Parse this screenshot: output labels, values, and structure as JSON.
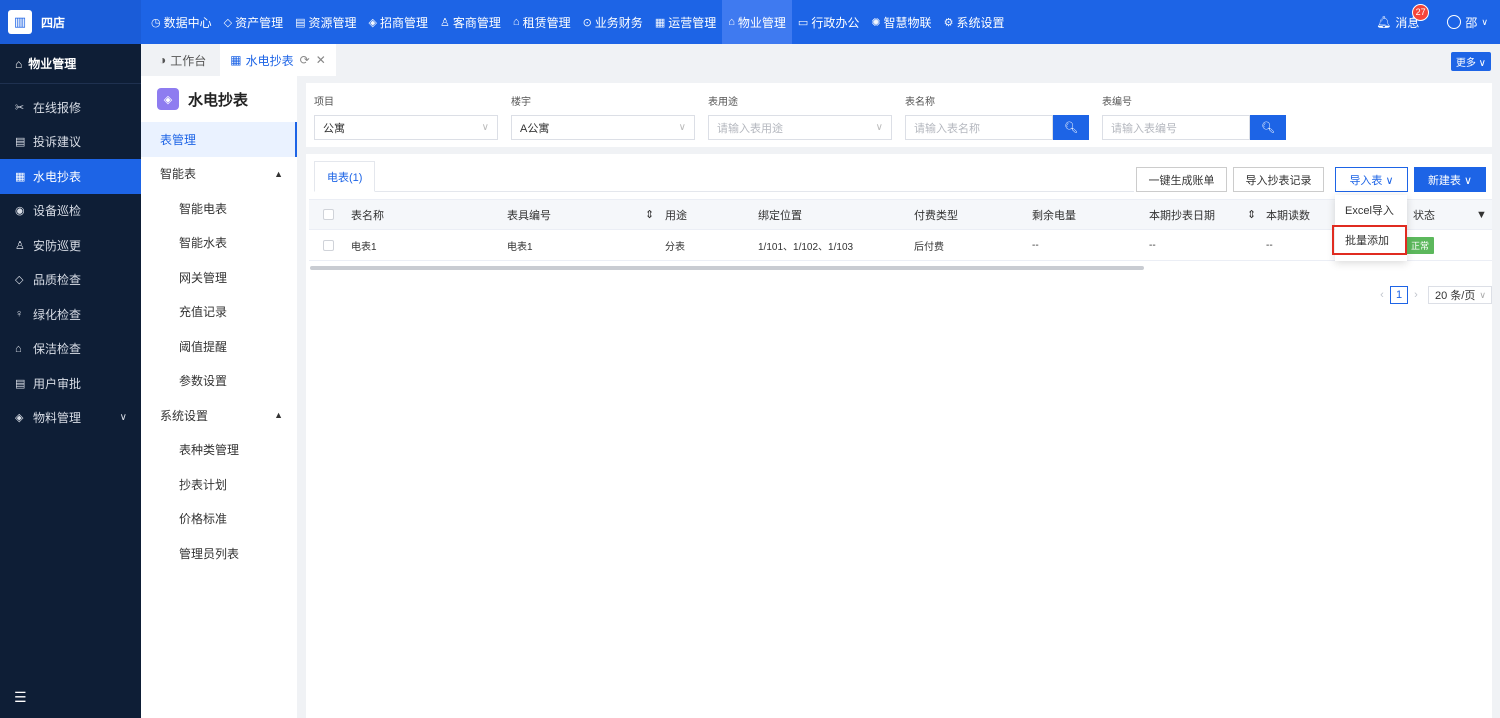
{
  "brand": {
    "name": "四店"
  },
  "nav": [
    {
      "label": "数据中心",
      "icon": "◷"
    },
    {
      "label": "资产管理",
      "icon": "◇"
    },
    {
      "label": "资源管理",
      "icon": "▤"
    },
    {
      "label": "招商管理",
      "icon": "◈"
    },
    {
      "label": "客商管理",
      "icon": "♙"
    },
    {
      "label": "租赁管理",
      "icon": "⌂"
    },
    {
      "label": "业务财务",
      "icon": "⊙"
    },
    {
      "label": "运营管理",
      "icon": "▦"
    },
    {
      "label": "物业管理",
      "icon": "⌂"
    },
    {
      "label": "行政办公",
      "icon": "▭"
    },
    {
      "label": "智慧物联",
      "icon": "✺"
    },
    {
      "label": "系统设置",
      "icon": "⚙"
    }
  ],
  "topright": {
    "messages": "消息",
    "badge": "27",
    "user": "邵"
  },
  "sidebar": {
    "header": "物业管理",
    "items": [
      {
        "label": "在线报修",
        "icon": "✂"
      },
      {
        "label": "投诉建议",
        "icon": "▤"
      },
      {
        "label": "水电抄表",
        "icon": "▦"
      },
      {
        "label": "设备巡检",
        "icon": "◉"
      },
      {
        "label": "安防巡更",
        "icon": "♙"
      },
      {
        "label": "品质检查",
        "icon": "◇"
      },
      {
        "label": "绿化检查",
        "icon": "♀"
      },
      {
        "label": "保洁检查",
        "icon": "⌂"
      },
      {
        "label": "用户审批",
        "icon": "▤"
      },
      {
        "label": "物料管理",
        "icon": "◈"
      }
    ],
    "collapse_icon": "☰"
  },
  "tabs": [
    {
      "label": "工作台",
      "icon": "◑"
    },
    {
      "label": "水电抄表",
      "icon": "▦"
    }
  ],
  "more_label": "更多 ∨",
  "subnav": {
    "title": "水电抄表",
    "items": [
      {
        "label": "表管理"
      },
      {
        "label": "智能表"
      },
      {
        "label": "智能电表"
      },
      {
        "label": "智能水表"
      },
      {
        "label": "网关管理"
      },
      {
        "label": "充值记录"
      },
      {
        "label": "阈值提醒"
      },
      {
        "label": "参数设置"
      },
      {
        "label": "系统设置"
      },
      {
        "label": "表种类管理"
      },
      {
        "label": "抄表计划"
      },
      {
        "label": "价格标准"
      },
      {
        "label": "管理员列表"
      }
    ]
  },
  "filters": {
    "project": {
      "label": "项目",
      "value": "公寓"
    },
    "building": {
      "label": "楼宇",
      "value": "A公寓"
    },
    "usage": {
      "label": "表用途",
      "placeholder": "请输入表用途"
    },
    "meter_name": {
      "label": "表名称",
      "placeholder": "请输入表名称"
    },
    "meter_no": {
      "label": "表编号",
      "placeholder": "请输入表编号"
    }
  },
  "content_tab": "电表(1)",
  "actions": {
    "generate_bill": "一键生成账单",
    "import_records": "导入抄表记录",
    "import_table": "导入表 ∨",
    "new_table": "新建表 ∨"
  },
  "dropdown": {
    "excel_import": "Excel导入",
    "batch_add": "批量添加"
  },
  "table": {
    "headers": [
      "表名称",
      "表具编号",
      "用途",
      "绑定位置",
      "付费类型",
      "剩余电量",
      "本期抄表日期",
      "本期读数",
      "状态"
    ],
    "rows": [
      [
        "电表1",
        "电表1",
        "分表",
        "1/101、1/102、1/103",
        "后付费",
        "--",
        "--",
        "--",
        "正常"
      ]
    ]
  },
  "pagination": {
    "page": "1",
    "page_size": "20 条/页"
  }
}
